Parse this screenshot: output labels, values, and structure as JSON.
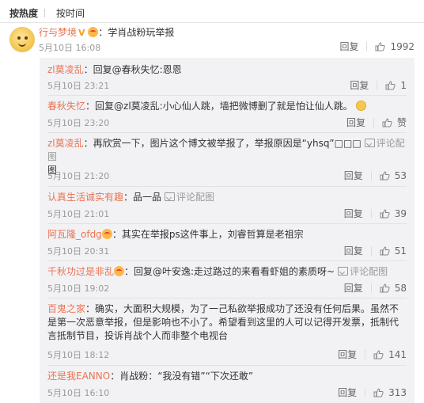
{
  "sort": {
    "hot": "按热度",
    "time": "按时间"
  },
  "main": {
    "user": "行与梦境",
    "text": "：学肖战粉玩举报",
    "time": "5月10日 16:08",
    "reply": "回复",
    "likes": "1992"
  },
  "pic_label": "评论配图",
  "replies": [
    {
      "user": "zl莫凌乱",
      "text": "：回复@春秋失忆:恩恩",
      "time": "5月10日 23:21",
      "reply": "回复",
      "likes": "1"
    },
    {
      "user": "春秋失忆",
      "text": "：回复@zl莫凌乱:小心仙人跳，墙把微博删了就是怕让仙人跳。",
      "time": "5月10日 23:20",
      "reply": "回复",
      "likes": "赞"
    },
    {
      "user": "zl莫凌乱",
      "text": "：再欣赏一下，图片这个博文被举报了，举报原因是“yhsq”□□□",
      "text2": "图",
      "time": "5月10日 21:20",
      "reply": "回复",
      "likes": "53"
    },
    {
      "user": "认真生活诚实有趣",
      "text": "：品一品",
      "time": "5月10日 21:01",
      "reply": "回复",
      "likes": "39"
    },
    {
      "user": "阿瓦隆_ofdg",
      "text": "：其实在举报ps这件事上，刘睿哲算是老祖宗",
      "time": "5月10日 20:31",
      "reply": "回复",
      "likes": "51"
    },
    {
      "user": "千秋功过是非乱",
      "text": "：回复@叶安逸:走过路过的来看看虾姐的素质呀~",
      "time": "5月10日 19:02",
      "reply": "回复",
      "likes": "58"
    },
    {
      "user": "百鬼之家",
      "text": "：确实，大面积大规模，为了一己私欲举报成功了还没有任何后果。虽然不",
      "text2": "是第一次恶意举报，但是影响也不小了。希望看到这里的人可以记得开发票，抵制代",
      "text3": "言抵制节目，投诉肖战个人而非整个电视台",
      "time": "5月10日 18:12",
      "reply": "回复",
      "likes": "141"
    },
    {
      "user": "还是我EANNO",
      "text": "：肖战粉：“我没有错”“下次还敢”",
      "time": "5月10日 16:10",
      "reply": "回复",
      "likes": "313"
    }
  ],
  "colors": {
    "username": "#eb7350",
    "meta": "#999999",
    "reply_bg": "#f2f2f5"
  },
  "icons": [
    "thumb-up-icon",
    "picture-icon",
    "vip-v-icon",
    "emoji-icon"
  ]
}
